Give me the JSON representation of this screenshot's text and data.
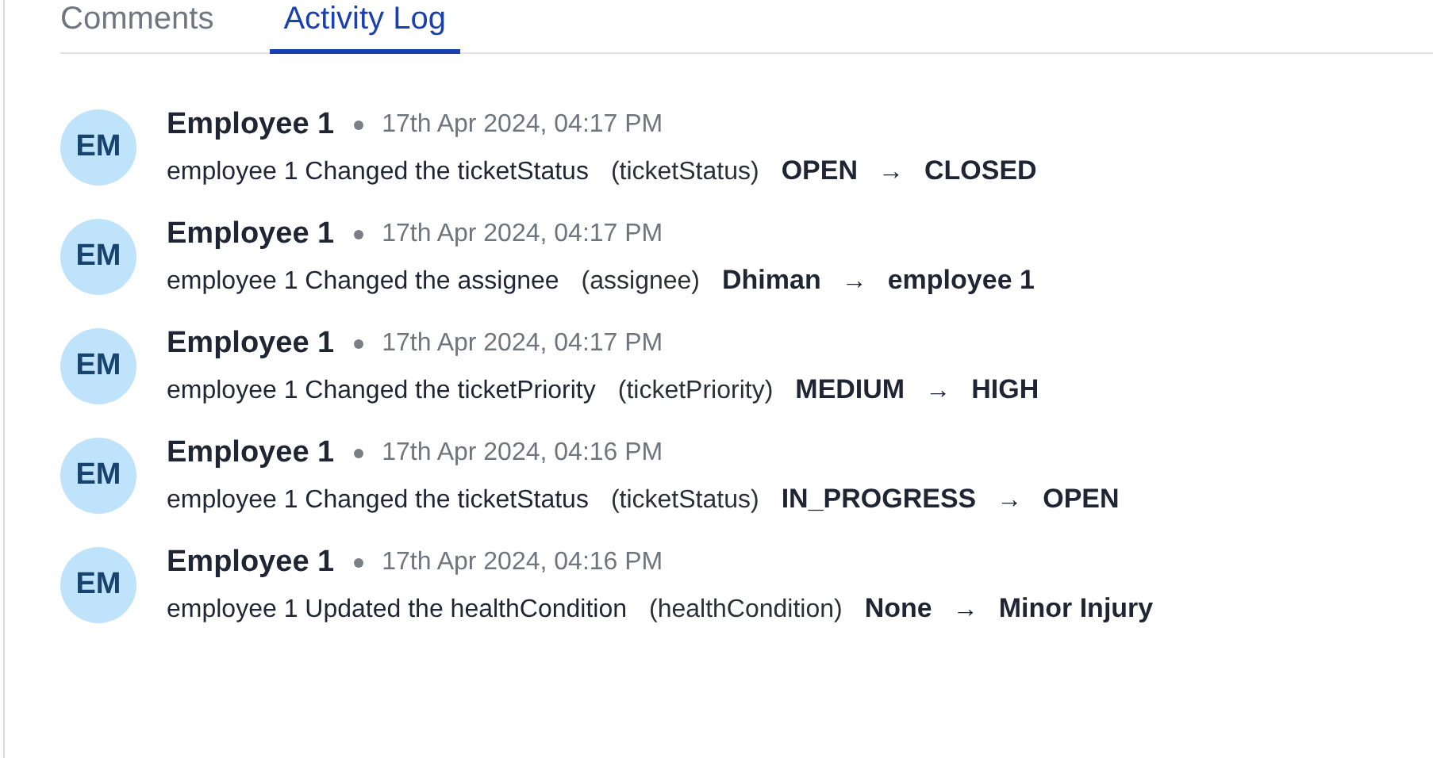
{
  "tabs": [
    {
      "label": "Comments",
      "selected": false
    },
    {
      "label": "Activity Log",
      "selected": true
    }
  ],
  "activities": [
    {
      "avatar": "EM",
      "author": "Employee 1",
      "time": "17th Apr 2024, 04:17 PM",
      "description": "employee 1 Changed the ticketStatus",
      "field": "(ticketStatus)",
      "from": "OPEN",
      "arrow": "→",
      "to": "CLOSED"
    },
    {
      "avatar": "EM",
      "author": "Employee 1",
      "time": "17th Apr 2024, 04:17 PM",
      "description": "employee 1 Changed the assignee",
      "field": "(assignee)",
      "from": "Dhiman",
      "arrow": "→",
      "to": "employee 1"
    },
    {
      "avatar": "EM",
      "author": "Employee 1",
      "time": "17th Apr 2024, 04:17 PM",
      "description": "employee 1 Changed the ticketPriority",
      "field": "(ticketPriority)",
      "from": "MEDIUM",
      "arrow": "→",
      "to": "HIGH"
    },
    {
      "avatar": "EM",
      "author": "Employee 1",
      "time": "17th Apr 2024, 04:16 PM",
      "description": "employee 1 Changed the ticketStatus",
      "field": "(ticketStatus)",
      "from": "IN_PROGRESS",
      "arrow": "→",
      "to": "OPEN"
    },
    {
      "avatar": "EM",
      "author": "Employee 1",
      "time": "17th Apr 2024, 04:16 PM",
      "description": "employee 1 Updated the healthCondition",
      "field": "(healthCondition)",
      "from": "None",
      "arrow": "→",
      "to": "Minor Injury"
    }
  ]
}
